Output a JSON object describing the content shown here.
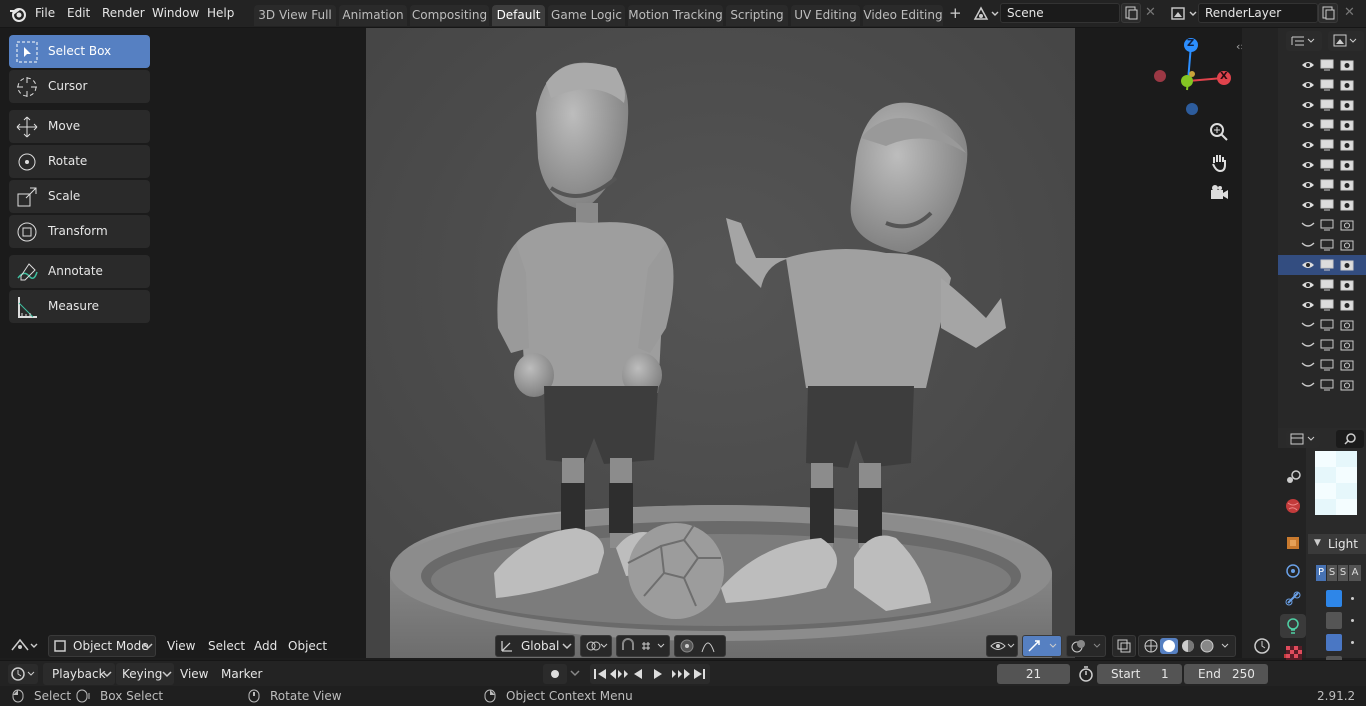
{
  "app": {
    "logo": "blender-logo-icon",
    "version": "2.91.2"
  },
  "menu": [
    "File",
    "Edit",
    "Render",
    "Window",
    "Help"
  ],
  "workspace_tabs": [
    {
      "label": "3D View Full",
      "active": false
    },
    {
      "label": "Animation",
      "active": false
    },
    {
      "label": "Compositing",
      "active": false
    },
    {
      "label": "Default",
      "active": true
    },
    {
      "label": "Game Logic",
      "active": false
    },
    {
      "label": "Motion Tracking",
      "active": false
    },
    {
      "label": "Scripting",
      "active": false
    },
    {
      "label": "UV Editing",
      "active": false
    },
    {
      "label": "Video Editing",
      "active": false
    }
  ],
  "scene": {
    "value": "Scene"
  },
  "render_layer": {
    "value": "RenderLayer"
  },
  "tools": [
    {
      "label": "Select Box",
      "icon": "select-box-icon",
      "active": true
    },
    {
      "label": "Cursor",
      "icon": "cursor-icon",
      "active": false
    },
    {
      "label": "Move",
      "icon": "move-icon",
      "active": false
    },
    {
      "label": "Rotate",
      "icon": "rotate-icon",
      "active": false
    },
    {
      "label": "Scale",
      "icon": "scale-icon",
      "active": false
    },
    {
      "label": "Transform",
      "icon": "transform-icon",
      "active": false
    },
    {
      "label": "Annotate",
      "icon": "annotate-icon",
      "active": false
    },
    {
      "label": "Measure",
      "icon": "measure-icon",
      "active": false
    }
  ],
  "gizmo": {
    "z": "Z",
    "x": "X",
    "colors": {
      "x": "#e0434c",
      "y": "#84c523",
      "z": "#2c8fff"
    }
  },
  "viewport_header": {
    "mode": "Object Mode",
    "menus": [
      "View",
      "Select",
      "Add",
      "Object"
    ],
    "orientation": "Global"
  },
  "outliner_rows": [
    {
      "visible": true,
      "selected": false
    },
    {
      "visible": true,
      "selected": false
    },
    {
      "visible": true,
      "selected": false
    },
    {
      "visible": true,
      "selected": false
    },
    {
      "visible": true,
      "selected": false
    },
    {
      "visible": true,
      "selected": false
    },
    {
      "visible": true,
      "selected": false
    },
    {
      "visible": true,
      "selected": false
    },
    {
      "visible": false,
      "selected": false
    },
    {
      "visible": false,
      "selected": false
    },
    {
      "visible": true,
      "selected": true
    },
    {
      "visible": true,
      "selected": false
    },
    {
      "visible": true,
      "selected": false
    },
    {
      "visible": false,
      "selected": false
    },
    {
      "visible": false,
      "selected": false
    },
    {
      "visible": false,
      "selected": false
    },
    {
      "visible": false,
      "selected": false
    }
  ],
  "properties": {
    "panel_label": "Light",
    "pssa": [
      "P",
      "S",
      "S",
      "A"
    ],
    "swatches": [
      "#2e86e8",
      "#555555",
      "#4a77c4",
      "#555555"
    ]
  },
  "timeline": {
    "menus": [
      "Playback",
      "Keying",
      "View",
      "Marker"
    ],
    "current_frame": "21",
    "start_label": "Start",
    "start_value": "1",
    "end_label": "End",
    "end_value": "250"
  },
  "status": {
    "items": [
      {
        "label": "Select",
        "icon": "mouse-left-icon"
      },
      {
        "label": "Box Select",
        "icon": "mouse-drag-icon"
      },
      {
        "label": "Rotate View",
        "icon": "mouse-middle-icon"
      },
      {
        "label": "Object Context Menu",
        "icon": "mouse-right-icon"
      }
    ]
  }
}
